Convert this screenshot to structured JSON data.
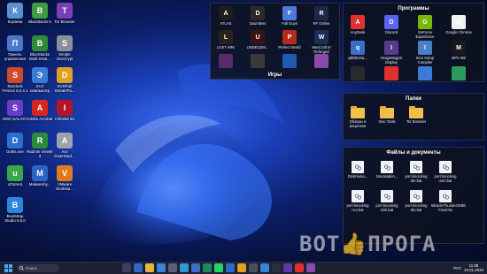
{
  "desktop_icons": [
    {
      "label": "Корзина",
      "icon": "recycle-bin-icon",
      "color": "#5b8fd6"
    },
    {
      "label": "BlueStacks 5",
      "icon": "bluestacks-icon",
      "color": "#3d9c3d"
    },
    {
      "label": "Tor Browser",
      "icon": "tor-icon",
      "color": "#7b3fb5"
    },
    {
      "label": "Панель управления",
      "icon": "control-panel-icon",
      "color": "#4a78c9"
    },
    {
      "label": "BlueStacks Multi-Insta...",
      "icon": "bluestacks-multi-icon",
      "color": "#2f8a3a"
    },
    {
      "label": "Simple OneCrypt",
      "icon": "onecrypt-icon",
      "color": "#8a8f99"
    },
    {
      "label": "Stardock Fences 5.0.4.1",
      "icon": "fences-icon",
      "color": "#d04a2a"
    },
    {
      "label": "Этот компьютер",
      "icon": "this-pc-icon",
      "color": "#3a7bd5"
    },
    {
      "label": "DVDFab StreamFa...",
      "icon": "dvdfab-icon",
      "color": "#e0a020"
    },
    {
      "label": "SDG GALAXY",
      "icon": "sdg-galaxy-icon",
      "color": "#6a3cc8"
    },
    {
      "label": "Adobe Acrobat",
      "icon": "acrobat-icon",
      "color": "#d8261c"
    },
    {
      "label": "InfinWw 64",
      "icon": "infinww-icon",
      "color": "#b5152a"
    },
    {
      "label": "Dottis.exe",
      "icon": "dottis-icon",
      "color": "#2c6fd0"
    },
    {
      "label": "Radmin Viewer 3",
      "icon": "radmin-icon",
      "color": "#2b8a3e"
    },
    {
      "label": "Ace Download...",
      "icon": "ace-download-icon",
      "color": "#9aa3ad"
    },
    {
      "label": "uTorrent",
      "icon": "utorrent-icon",
      "color": "#3aa64a"
    },
    {
      "label": "Malwareby...",
      "icon": "malwarebytes-icon",
      "color": "#2a65c4"
    },
    {
      "label": "VMware Worksta...",
      "icon": "vmware-icon",
      "color": "#e07a1a"
    },
    {
      "label": "Bootstrap Studio 6.6.0",
      "icon": "bootstrap-studio-icon",
      "color": "#2c86d9"
    }
  ],
  "games_panel": {
    "title": "Игры",
    "items": [
      {
        "label": "ATLAS",
        "icon": "atlas-icon",
        "color": "#1e1e1e"
      },
      {
        "label": "Dauntless",
        "icon": "dauntless-icon",
        "color": "#2a2a2a"
      },
      {
        "label": "Fall Guys",
        "icon": "fall-guys-icon",
        "color": "#4a7ae0"
      },
      {
        "label": "RF Online",
        "icon": "rf-online-icon",
        "color": "#1c2a48"
      },
      {
        "label": "LOST ARK",
        "icon": "lost-ark-icon",
        "color": "#2a2218"
      },
      {
        "label": "UNDECEM...",
        "icon": "undecember-icon",
        "color": "#3a1414"
      },
      {
        "label": "Perfect World",
        "icon": "perfect-world-icon",
        "color": "#b52a1e"
      },
      {
        "label": "WarCraft III Reforged",
        "icon": "warcraft-icon",
        "color": "#1e2c5a"
      },
      {
        "label": "",
        "icon": "game-icon-9",
        "color": "#5a2a6a"
      },
      {
        "label": "",
        "icon": "game-icon-10",
        "color": "#3a3a3a"
      },
      {
        "label": "",
        "icon": "game-icon-11",
        "color": "#1f5ab0"
      },
      {
        "label": "",
        "icon": "game-icon-12",
        "color": "#8a4aa8"
      }
    ]
  },
  "programs_panel": {
    "title": "Программы",
    "items": [
      {
        "label": "AnyDesk",
        "icon": "anydesk-icon",
        "color": "#e0312e"
      },
      {
        "label": "Discord",
        "icon": "discord-icon",
        "color": "#5865f2"
      },
      {
        "label": "GeForce Experience",
        "icon": "geforce-icon",
        "color": "#76b900"
      },
      {
        "label": "Google Chrome",
        "icon": "chrome-icon",
        "color": "#f2f2f2"
      },
      {
        "label": "qBittExtra...",
        "icon": "qbittorrent-icon",
        "color": "#3a6fc4"
      },
      {
        "label": "ImageMagick Display",
        "icon": "imagemagick-icon",
        "color": "#5a3a8a"
      },
      {
        "label": "Inno Setup Compiler",
        "icon": "inno-setup-icon",
        "color": "#4a80c8"
      },
      {
        "label": "MPC-BE",
        "icon": "mpc-be-icon",
        "color": "#1a1a1a"
      },
      {
        "label": "",
        "icon": "program-icon-9",
        "color": "#2a2a2a"
      },
      {
        "label": "",
        "icon": "program-icon-10",
        "color": "#e0312e"
      },
      {
        "label": "",
        "icon": "program-icon-11",
        "color": "#3a7bd5"
      },
      {
        "label": "",
        "icon": "program-icon-12",
        "color": "#2e9a5a"
      }
    ]
  },
  "folders_panel": {
    "title": "Папки",
    "items": [
      {
        "label": "Обзоры и рецензии",
        "icon": "folder-icon"
      },
      {
        "label": "Inno Tools",
        "icon": "folder-icon"
      },
      {
        "label": "Tor Browser",
        "icon": "folder-icon"
      }
    ]
  },
  "files_panel": {
    "title": "Файлы и документы",
    "items": [
      {
        "label": "Dmitrevka...",
        "icon": "document-icon"
      },
      {
        "label": "Novosation...",
        "icon": "document-icon"
      },
      {
        "label": "port knocking dm.bat",
        "icon": "document-icon"
      },
      {
        "label": "port knocking uvm.bat",
        "icon": "document-icon"
      },
      {
        "label": "port knocking ncv.bat",
        "icon": "document-icon"
      },
      {
        "label": "port knocking rdm.bat",
        "icon": "document-icon"
      },
      {
        "label": "port knocking dm.bat",
        "icon": "document-icon"
      },
      {
        "label": "MiracleThunder32Bit Fixed.bx",
        "icon": "installer-icon"
      }
    ]
  },
  "watermark": {
    "part1": "ВОТ",
    "part2": "ПРОГА"
  },
  "taskbar": {
    "search_placeholder": "Поиск",
    "apps": [
      {
        "icon": "task-view-icon",
        "color": "#3a4060"
      },
      {
        "icon": "taskbar-app-1-icon",
        "color": "#2d6ac8"
      },
      {
        "icon": "file-explorer-icon",
        "color": "#e6b43a"
      },
      {
        "icon": "taskbar-app-3-icon",
        "color": "#3a82d9"
      },
      {
        "icon": "taskbar-app-4-icon",
        "color": "#5a6078"
      },
      {
        "icon": "taskbar-app-5-icon",
        "color": "#2a9ad6"
      },
      {
        "icon": "taskbar-app-6-icon",
        "color": "#3a6fc8"
      },
      {
        "icon": "taskbar-app-7-icon",
        "color": "#1e8a5a"
      },
      {
        "icon": "whatsapp-icon",
        "color": "#25d366"
      },
      {
        "icon": "taskbar-app-9-icon",
        "color": "#2d6ac8"
      },
      {
        "icon": "taskbar-app-10-icon",
        "color": "#e0a020"
      },
      {
        "icon": "taskbar-app-11-icon",
        "color": "#4a4f5e"
      },
      {
        "icon": "taskbar-app-12-icon",
        "color": "#3a82d9"
      },
      {
        "icon": "taskbar-app-13-icon",
        "color": "#2a2e3e"
      },
      {
        "icon": "taskbar-app-14-icon",
        "color": "#5a3aa8"
      },
      {
        "icon": "taskbar-app-15-icon",
        "color": "#e0312e"
      },
      {
        "icon": "taskbar-app-16-icon",
        "color": "#8a4aa8"
      }
    ],
    "language": "РУС",
    "time": "11:08",
    "date": "10.01.2024"
  }
}
